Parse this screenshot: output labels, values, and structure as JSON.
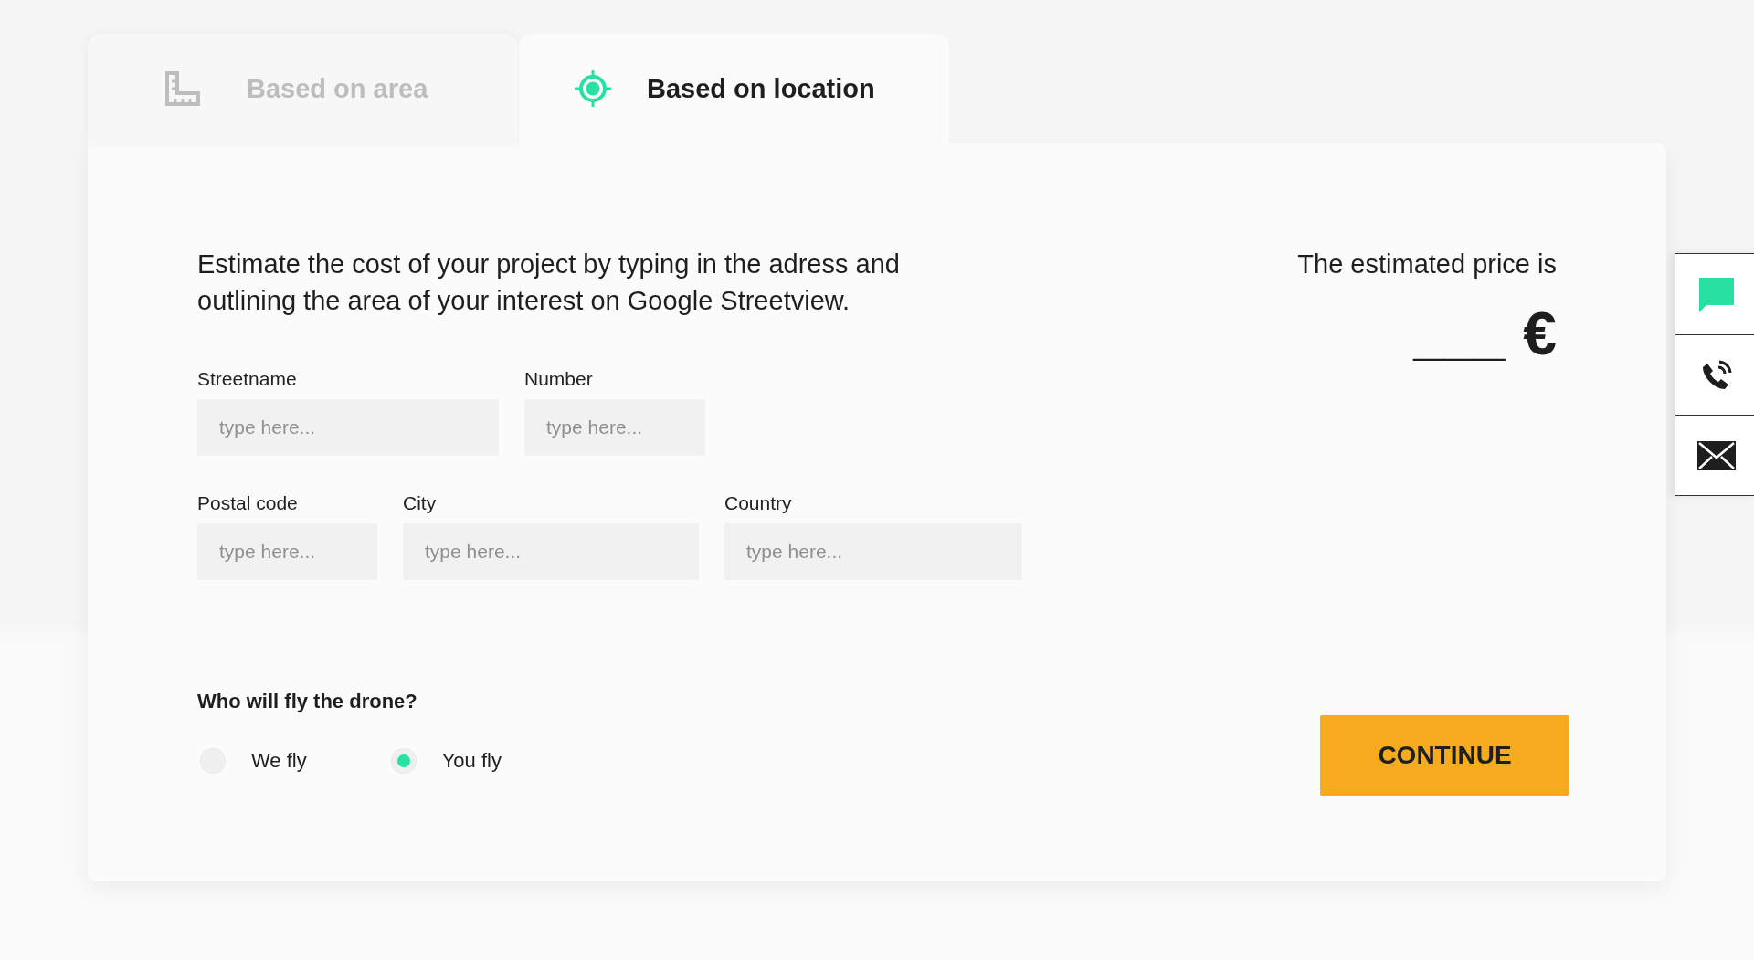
{
  "tabs": [
    {
      "kind": "area",
      "label": "Based on area",
      "selected": false
    },
    {
      "kind": "location",
      "label": "Based on location",
      "selected": true
    }
  ],
  "intro": "Estimate the cost of your project by typing in the adress and outlining the area of your interest on Google Streetview.",
  "address_rows": [
    [
      {
        "label": "Streetname",
        "placeholder": "type here..."
      },
      {
        "label": "Number",
        "placeholder": "type here..."
      }
    ],
    [
      {
        "label": "Postal code",
        "placeholder": "type here..."
      },
      {
        "label": "City",
        "placeholder": "type here..."
      },
      {
        "label": "Country",
        "placeholder": "type here..."
      }
    ]
  ],
  "pilot": {
    "question": "Who will fly the drone?",
    "options": [
      {
        "label": "We fly",
        "selected": false
      },
      {
        "label": "You fly",
        "selected": true
      }
    ]
  },
  "price": {
    "caption": "The estimated price is",
    "value": "___",
    "currency": "€"
  },
  "continue_button": "CONTINUE"
}
